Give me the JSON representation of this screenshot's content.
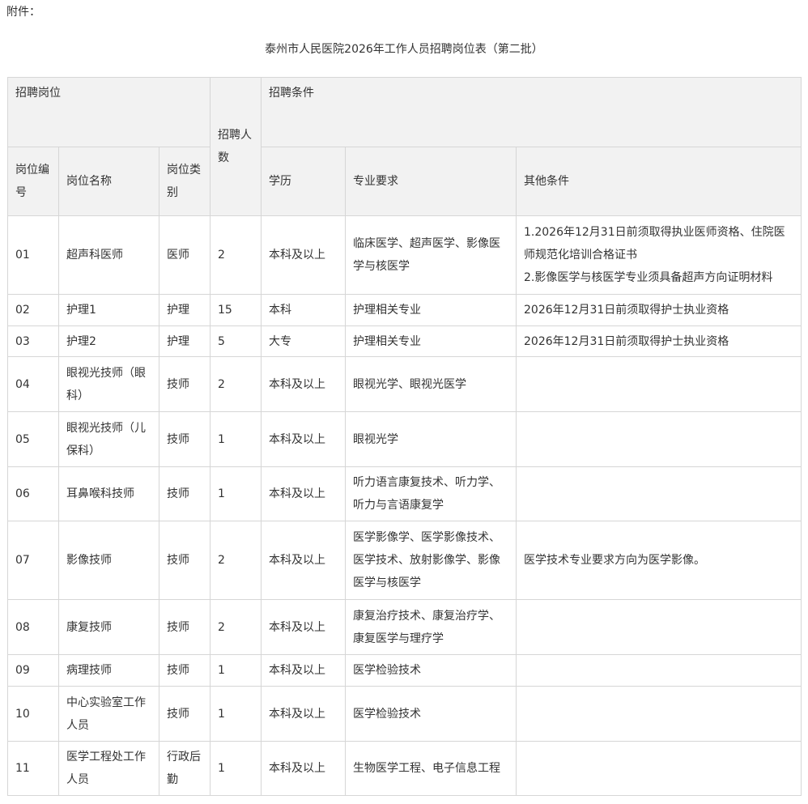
{
  "attachment_label": "附件：",
  "title": "泰州市人民医院2026年工作人员招聘岗位表（第二批）",
  "header": {
    "group_position": "招聘岗位",
    "count": "招聘人数",
    "group_conditions": "招聘条件",
    "code": "岗位编号",
    "name": "岗位名称",
    "category": "岗位类别",
    "education": "学历",
    "major": "专业要求",
    "other": "其他条件"
  },
  "rows": [
    {
      "code": "01",
      "name": "超声科医师",
      "category": "医师",
      "count": "2",
      "education": "本科及以上",
      "major": "临床医学、超声医学、影像医学与核医学",
      "other": "1.2026年12月31日前须取得执业医师资格、住院医师规范化培训合格证书\n2.影像医学与核医学专业须具备超声方向证明材料"
    },
    {
      "code": "02",
      "name": "护理1",
      "category": "护理",
      "count": "15",
      "education": "本科",
      "major": "护理相关专业",
      "other": "2026年12月31日前须取得护士执业资格"
    },
    {
      "code": "03",
      "name": "护理2",
      "category": "护理",
      "count": "5",
      "education": "大专",
      "major": "护理相关专业",
      "other": "2026年12月31日前须取得护士执业资格"
    },
    {
      "code": "04",
      "name": "眼视光技师（眼科）",
      "category": "技师",
      "count": "2",
      "education": "本科及以上",
      "major": "眼视光学、眼视光医学",
      "other": ""
    },
    {
      "code": "05",
      "name": "眼视光技师（儿保科）",
      "category": "技师",
      "count": "1",
      "education": "本科及以上",
      "major": "眼视光学",
      "other": ""
    },
    {
      "code": "06",
      "name": "耳鼻喉科技师",
      "category": "技师",
      "count": "1",
      "education": "本科及以上",
      "major": "听力语言康复技术、听力学、听力与言语康复学",
      "other": ""
    },
    {
      "code": "07",
      "name": "影像技师",
      "category": "技师",
      "count": "2",
      "education": "本科及以上",
      "major": "医学影像学、医学影像技术、医学技术、放射影像学、影像医学与核医学",
      "other": "医学技术专业要求方向为医学影像。"
    },
    {
      "code": "08",
      "name": "康复技师",
      "category": "技师",
      "count": "2",
      "education": "本科及以上",
      "major": "康复治疗技术、康复治疗学、康复医学与理疗学",
      "other": ""
    },
    {
      "code": "09",
      "name": "病理技师",
      "category": "技师",
      "count": "1",
      "education": "本科及以上",
      "major": "医学检验技术",
      "other": ""
    },
    {
      "code": "10",
      "name": "中心实验室工作人员",
      "category": "技师",
      "count": "1",
      "education": "本科及以上",
      "major": "医学检验技术",
      "other": ""
    },
    {
      "code": "11",
      "name": "医学工程处工作人员",
      "category": "行政后勤",
      "count": "1",
      "education": "本科及以上",
      "major": "生物医学工程、电子信息工程",
      "other": ""
    }
  ]
}
